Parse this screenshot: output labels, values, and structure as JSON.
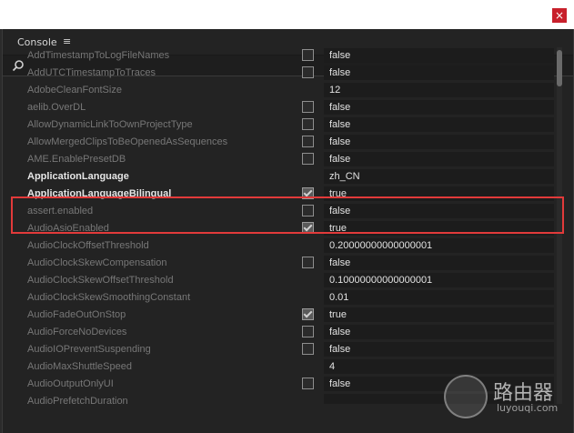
{
  "window": {
    "close_glyph": "×"
  },
  "tab": {
    "label": "Console",
    "menu_glyph": "≡"
  },
  "search": {
    "placeholder": ""
  },
  "rows": [
    {
      "key": "AddTimestampToLogFileNames",
      "check": "off",
      "value": "false"
    },
    {
      "key": "AddUTCTimestampToTraces",
      "check": "off",
      "value": "false"
    },
    {
      "key": "AdobeCleanFontSize",
      "check": "none",
      "value": "12"
    },
    {
      "key": "aelib.OverDL",
      "check": "off",
      "value": "false"
    },
    {
      "key": "AllowDynamicLinkToOwnProjectType",
      "check": "off",
      "value": "false"
    },
    {
      "key": "AllowMergedClipsToBeOpenedAsSequences",
      "check": "off",
      "value": "false"
    },
    {
      "key": "AME.EnablePresetDB",
      "check": "off",
      "value": "false"
    },
    {
      "key": "ApplicationLanguage",
      "check": "none",
      "value": "zh_CN",
      "active": true
    },
    {
      "key": "ApplicationLanguageBilingual",
      "check": "on",
      "value": "true",
      "active": true
    },
    {
      "key": "assert.enabled",
      "check": "off",
      "value": "false"
    },
    {
      "key": "AudioAsioEnabled",
      "check": "on",
      "value": "true"
    },
    {
      "key": "AudioClockOffsetThreshold",
      "check": "none",
      "value": "0.20000000000000001"
    },
    {
      "key": "AudioClockSkewCompensation",
      "check": "off",
      "value": "false"
    },
    {
      "key": "AudioClockSkewOffsetThreshold",
      "check": "none",
      "value": "0.10000000000000001"
    },
    {
      "key": "AudioClockSkewSmoothingConstant",
      "check": "none",
      "value": "0.01"
    },
    {
      "key": "AudioFadeOutOnStop",
      "check": "on",
      "value": "true"
    },
    {
      "key": "AudioForceNoDevices",
      "check": "off",
      "value": "false"
    },
    {
      "key": "AudioIOPreventSuspending",
      "check": "off",
      "value": "false"
    },
    {
      "key": "AudioMaxShuttleSpeed",
      "check": "none",
      "value": "4"
    },
    {
      "key": "AudioOutputOnlyUI",
      "check": "off",
      "value": "false"
    },
    {
      "key": "AudioPrefetchDuration",
      "check": "none",
      "value": ""
    }
  ],
  "watermark": {
    "main": "路由器",
    "sub": "luyouqi.com"
  }
}
